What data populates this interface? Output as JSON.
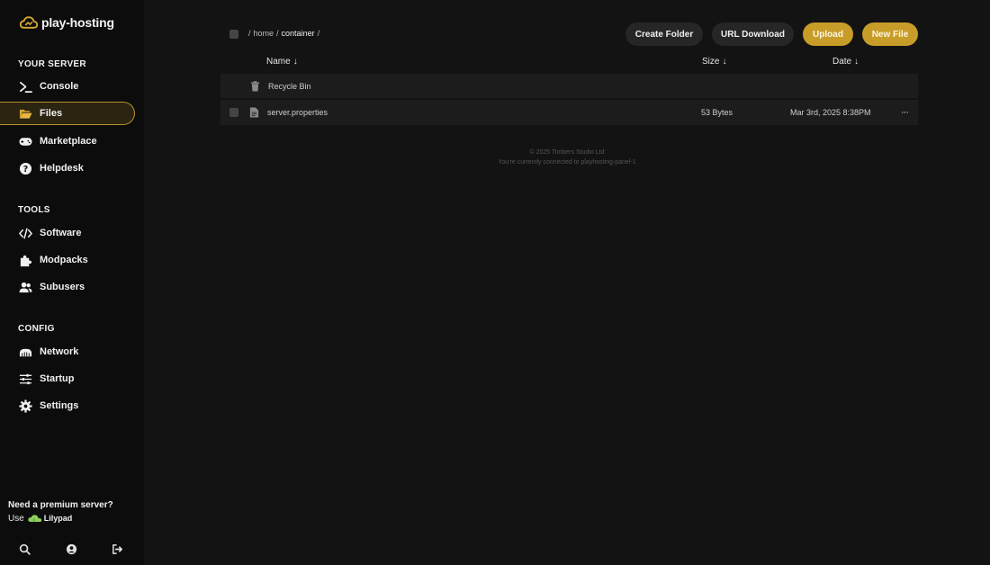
{
  "brand": {
    "name": "play-hosting"
  },
  "sidebar": {
    "sections": [
      {
        "title": "YOUR SERVER",
        "items": [
          {
            "label": "Console",
            "icon": "terminal-icon"
          },
          {
            "label": "Files",
            "icon": "folder-icon",
            "active": true
          },
          {
            "label": "Marketplace",
            "icon": "gamepad-icon"
          },
          {
            "label": "Helpdesk",
            "icon": "help-icon"
          }
        ]
      },
      {
        "title": "TOOLS",
        "items": [
          {
            "label": "Software",
            "icon": "code-icon"
          },
          {
            "label": "Modpacks",
            "icon": "puzzle-icon"
          },
          {
            "label": "Subusers",
            "icon": "users-icon"
          }
        ]
      },
      {
        "title": "CONFIG",
        "items": [
          {
            "label": "Network",
            "icon": "network-icon"
          },
          {
            "label": "Startup",
            "icon": "sliders-icon"
          },
          {
            "label": "Settings",
            "icon": "gear-icon"
          }
        ]
      }
    ],
    "premium": {
      "title": "Need a premium server?",
      "use": "Use",
      "partner": "Lilypad"
    }
  },
  "main": {
    "breadcrumb": {
      "sep": "/",
      "home": "home",
      "current": "container"
    },
    "buttons": {
      "create_folder": "Create Folder",
      "url_download": "URL Download",
      "upload": "Upload",
      "new_file": "New File"
    },
    "columns": {
      "name": "Name",
      "size": "Size",
      "date": "Date",
      "sort_arrow": "↓"
    },
    "rows": [
      {
        "name": "Recycle Bin",
        "size": "",
        "date": "",
        "icon": "trash-icon"
      },
      {
        "name": "server.properties",
        "size": "53 Bytes",
        "date": "Mar 3rd, 2025 8:38PM",
        "icon": "file-icon",
        "menu": "···"
      }
    ],
    "footer": {
      "copyright": "© 2025 Timbers Studio Ltd",
      "connection": "You're currently connected to playhosting-panel-1"
    }
  },
  "colors": {
    "accent": "#c89c28",
    "background": "#131313",
    "sidebar": "#0c0c0c",
    "row": "#1c1c1c"
  }
}
